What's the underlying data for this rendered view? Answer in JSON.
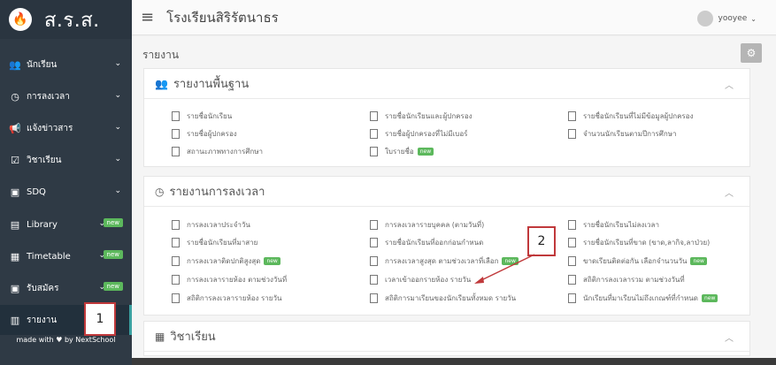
{
  "brand": {
    "name": "ส.ร.ส."
  },
  "header": {
    "title": "โรงเรียนสิริรัตนาธร",
    "user": "yooyee"
  },
  "sidebar": {
    "items": [
      {
        "label": "นักเรียน",
        "icon": "users-icon",
        "new": false
      },
      {
        "label": "การลงเวลา",
        "icon": "clock-icon",
        "new": false
      },
      {
        "label": "แจ้งข่าวสาร",
        "icon": "bullhorn-icon",
        "new": false
      },
      {
        "label": "วิชาเรียน",
        "icon": "calendar-check-icon",
        "new": false
      },
      {
        "label": "SDQ",
        "icon": "clipboard-icon",
        "new": false
      },
      {
        "label": "Library",
        "icon": "book-icon",
        "new": true
      },
      {
        "label": "Timetable",
        "icon": "table-icon",
        "new": true
      },
      {
        "label": "รับสมัคร",
        "icon": "form-icon",
        "new": true
      },
      {
        "label": "รายงาน",
        "icon": "chart-icon",
        "new": false
      }
    ],
    "new_label": "new",
    "footer": "made with ♥ by NextSchool"
  },
  "page": {
    "title": "รายงาน"
  },
  "cards": {
    "basic": {
      "title": "รายงานพื้นฐาน",
      "items": [
        "รายชื่อนักเรียน",
        "รายชื่อนักเรียนและผู้ปกครอง",
        "รายชื่อนักเรียนที่ไม่มีข้อมูลผู้ปกครอง",
        "รายชื่อผู้ปกครอง",
        "รายชื่อผู้ปกครองที่ไม่มีเบอร์",
        "จำนวนนักเรียนตามปีการศึกษา",
        "สถานะภาพทางการศึกษา",
        "ใบรายชื่อ"
      ]
    },
    "attendance": {
      "title": "รายงานการลงเวลา",
      "items": [
        "การลงเวลาประจำวัน",
        "การลงเวลารายบุคคล (ตามวันที่)",
        "รายชื่อนักเรียนไม่ลงเวลา",
        "รายชื่อนักเรียนที่มาสาย",
        "รายชื่อนักเรียนที่ออกก่อนกำหนด",
        "รายชื่อนักเรียนที่ขาด (ขาด,ลากิจ,ลาป่วย)",
        "การลงเวลาติดปกติสูงสุด",
        "การลงเวลาสูงสุด ตามช่วงเวลาที่เลือก",
        "ขาดเรียนติดต่อกัน เลือกจำนวนวัน",
        "การลงเวลารายห้อง ตามช่วงวันที่",
        "เวลาเข้าออกรายห้อง รายวัน",
        "สถิติการลงเวลารวม ตามช่วงวันที่",
        "สถิติการลงเวลารายห้อง รายวัน",
        "สถิติการมาเรียนของนักเรียนทั้งหมด รายวัน",
        "นักเรียนที่มาเรียนไม่ถึงเกณฑ์ที่กำหนด"
      ]
    },
    "subjects": {
      "title": "วิชาเรียน"
    }
  },
  "annotations": {
    "one": "1",
    "two": "2"
  },
  "colors": {
    "sidebar": "#2f3a45",
    "new_badge": "#5cb85c",
    "annotation": "#c0393b"
  }
}
